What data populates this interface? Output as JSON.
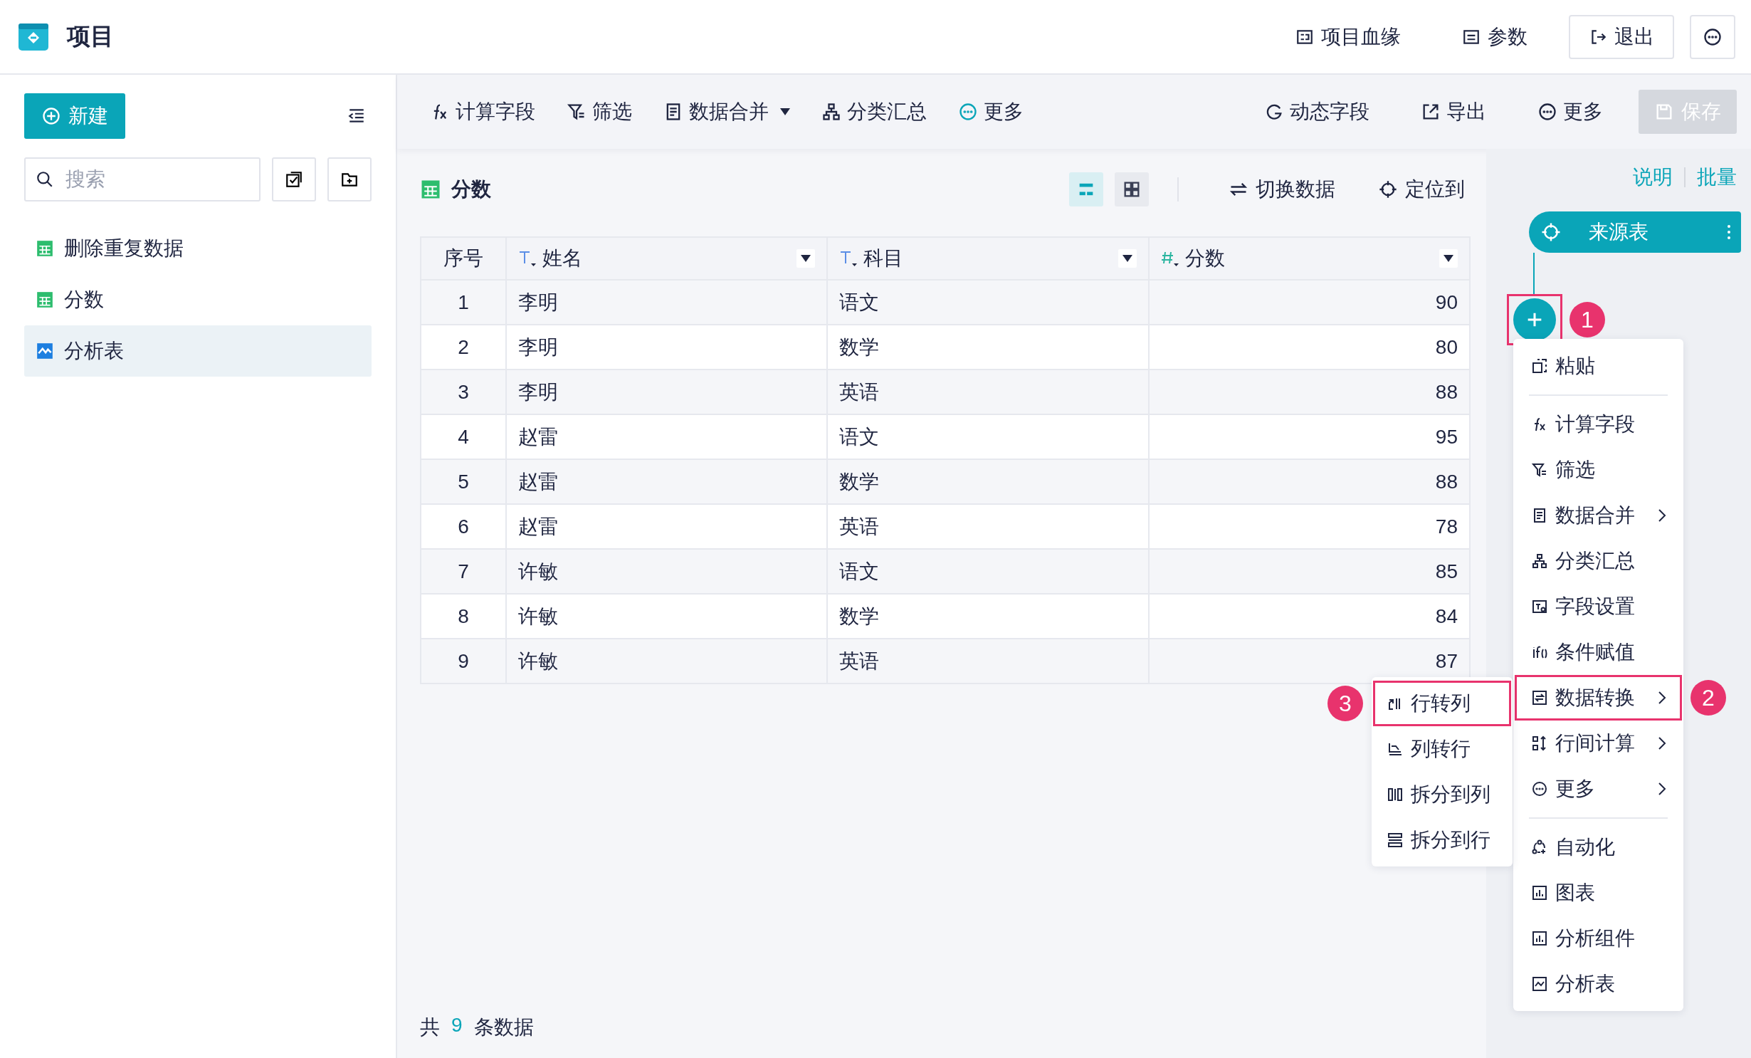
{
  "header": {
    "title": "项目",
    "actions": [
      {
        "kind": "plain",
        "label": "项目血缘"
      },
      {
        "kind": "plain",
        "label": "参数"
      },
      {
        "kind": "outlined",
        "label": "退出"
      },
      {
        "kind": "more"
      }
    ]
  },
  "sidebar": {
    "new_button": "新建",
    "search": {
      "placeholder": "搜索"
    },
    "items": [
      {
        "kind": "table",
        "label": "删除重复数据",
        "selected": false
      },
      {
        "kind": "table",
        "label": "分数",
        "selected": false
      },
      {
        "kind": "analysis",
        "label": "分析表",
        "selected": true
      }
    ]
  },
  "toolbar": {
    "left": [
      {
        "label": "计算字段",
        "dropdown": false
      },
      {
        "label": "筛选",
        "dropdown": false
      },
      {
        "label": "数据合并",
        "dropdown": true
      },
      {
        "label": "分类汇总",
        "dropdown": false
      },
      {
        "label": "更多",
        "dropdown": false
      }
    ],
    "right": [
      {
        "label": "动态字段"
      },
      {
        "label": "导出"
      },
      {
        "label": "更多"
      }
    ],
    "save": {
      "label": "保存",
      "disabled": true
    }
  },
  "dataset": {
    "title": "分数",
    "view_modes": [
      {
        "selected": true
      },
      {
        "selected": false
      }
    ],
    "actions": [
      "切换数据",
      "定位到"
    ]
  },
  "table": {
    "columns": [
      {
        "label": "序号",
        "kind": "index"
      },
      {
        "label": "姓名",
        "kind": "text"
      },
      {
        "label": "科目",
        "kind": "text"
      },
      {
        "label": "分数",
        "kind": "number"
      }
    ],
    "rows": [
      [
        "1",
        "李明",
        "语文",
        "90"
      ],
      [
        "2",
        "李明",
        "数学",
        "80"
      ],
      [
        "3",
        "李明",
        "英语",
        "88"
      ],
      [
        "4",
        "赵雷",
        "语文",
        "95"
      ],
      [
        "5",
        "赵雷",
        "数学",
        "88"
      ],
      [
        "6",
        "赵雷",
        "英语",
        "78"
      ],
      [
        "7",
        "许敏",
        "语文",
        "85"
      ],
      [
        "8",
        "许敏",
        "数学",
        "84"
      ],
      [
        "9",
        "许敏",
        "英语",
        "87"
      ]
    ]
  },
  "footer": {
    "prefix": "共",
    "count": "9",
    "suffix": "条数据"
  },
  "flow": {
    "links": [
      "说明",
      "批量"
    ],
    "source_node": "来源表",
    "add_button": {
      "highlighted": true,
      "callout": "1"
    }
  },
  "menu": {
    "groups": [
      [
        {
          "label": "粘贴",
          "submenu": false,
          "highlighted": false
        }
      ],
      [
        {
          "label": "计算字段",
          "submenu": false,
          "highlighted": false
        },
        {
          "label": "筛选",
          "submenu": false,
          "highlighted": false
        },
        {
          "label": "数据合并",
          "submenu": true,
          "highlighted": false
        },
        {
          "label": "分类汇总",
          "submenu": false,
          "highlighted": false
        },
        {
          "label": "字段设置",
          "submenu": false,
          "highlighted": false
        },
        {
          "label": "条件赋值",
          "submenu": false,
          "highlighted": false
        },
        {
          "label": "数据转换",
          "submenu": true,
          "highlighted": true,
          "callout": "2"
        },
        {
          "label": "行间计算",
          "submenu": true,
          "highlighted": false
        },
        {
          "label": "更多",
          "submenu": true,
          "highlighted": false
        }
      ],
      [
        {
          "label": "自动化",
          "submenu": false,
          "highlighted": false
        },
        {
          "label": "图表",
          "submenu": false,
          "highlighted": false
        },
        {
          "label": "分析组件",
          "submenu": false,
          "highlighted": false
        },
        {
          "label": "分析表",
          "submenu": false,
          "highlighted": false
        }
      ]
    ]
  },
  "submenu": {
    "items": [
      {
        "label": "行转列",
        "highlighted": true,
        "callout": "3"
      },
      {
        "label": "列转行",
        "highlighted": false
      },
      {
        "label": "拆分到列",
        "highlighted": false
      },
      {
        "label": "拆分到行",
        "highlighted": false
      }
    ]
  }
}
